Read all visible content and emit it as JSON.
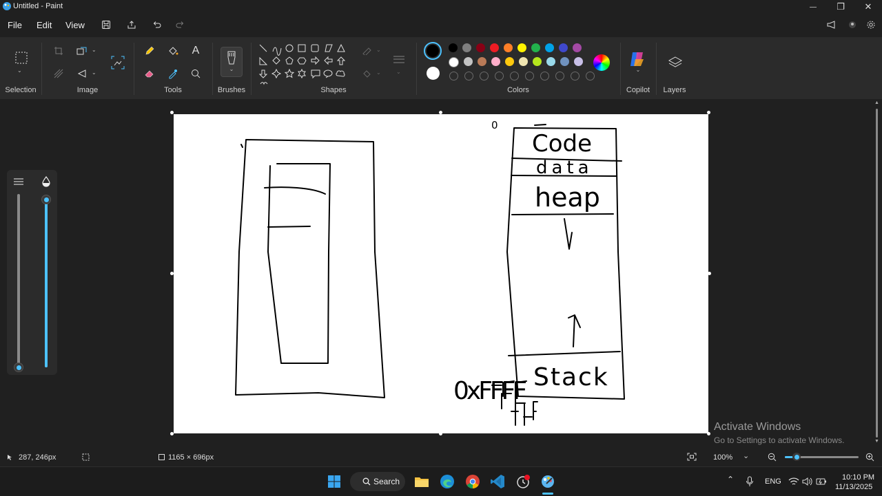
{
  "window": {
    "title": "Untitled - Paint",
    "minimize_glyph": "—",
    "maximize_glyph": "❐",
    "close_glyph": "✕"
  },
  "menu": {
    "file": "File",
    "edit": "Edit",
    "view": "View"
  },
  "ribbon": {
    "groups": {
      "selection": "Selection",
      "image": "Image",
      "tools": "Tools",
      "brushes": "Brushes",
      "shapes": "Shapes",
      "colors": "Colors",
      "copilot": "Copilot",
      "layers": "Layers"
    },
    "palette_row1": [
      "#000000",
      "#7f7f7f",
      "#880015",
      "#ed1c24",
      "#ff7f27",
      "#fff200",
      "#22b14c",
      "#00a2e8",
      "#3f48cc",
      "#a349a4"
    ],
    "palette_row2": [
      "#ffffff",
      "#c3c3c3",
      "#b97a57",
      "#ffaec9",
      "#ffc90e",
      "#efe4b0",
      "#b5e61d",
      "#99d9ea",
      "#7092be",
      "#c8bfe7"
    ],
    "primary_color": "#000000",
    "secondary_color": "#ffffff",
    "accent": "#4cc2ff"
  },
  "canvas_drawing": {
    "label_code": "Code",
    "label_data": "data",
    "label_heap": "heap",
    "label_stack": "Stack",
    "label_zero": "0",
    "label_hex": "0xFFFF"
  },
  "sliders": {
    "size_level": 0.0,
    "opacity_level": 1.0
  },
  "status": {
    "cursor_pos": "287, 246px",
    "canvas_size": "1165 × 696px",
    "zoom": "100%"
  },
  "watermark": {
    "title": "Activate Windows",
    "subtitle": "Go to Settings to activate Windows."
  },
  "taskbar": {
    "search_label": "Search",
    "language": "ENG",
    "time": "10:10 PM",
    "date": "11/13/2025"
  }
}
